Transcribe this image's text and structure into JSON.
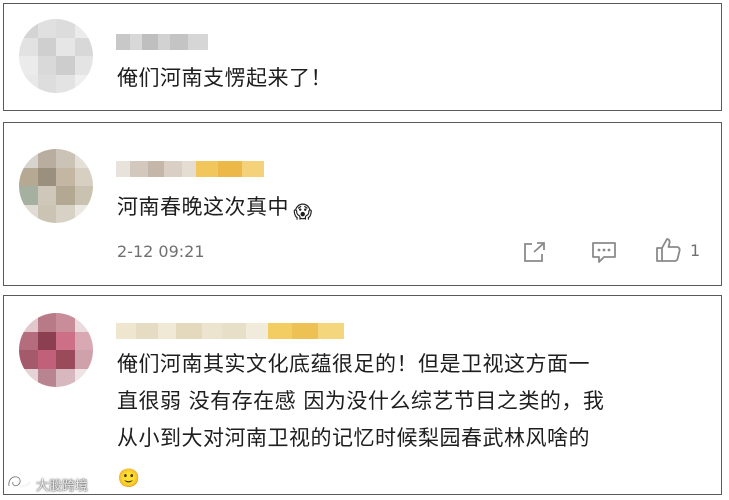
{
  "comments": [
    {
      "text": "俺们河南支愣起来了！"
    },
    {
      "text": "河南春晚这次真中",
      "emoji": "😱",
      "timestamp": "2-12 09:21",
      "like_count": "1",
      "actions": [
        "share-icon",
        "reply-icon",
        "like-icon"
      ]
    },
    {
      "lines": [
        "俺们河南其实文化底蕴很足的！但是卫视这方面一",
        "直很弱 没有存在感 因为没什么综艺节目之类的，我",
        "从小到大对河南卫视的记忆时候梨园春武林风啥的"
      ],
      "emoji": "🙂"
    }
  ],
  "watermark": {
    "text": "大股跨境"
  },
  "colors": {
    "card_border": "#5a5a5a",
    "text": "#1e1e1e",
    "meta_text": "#707070",
    "icon": "#8a8a8a"
  }
}
